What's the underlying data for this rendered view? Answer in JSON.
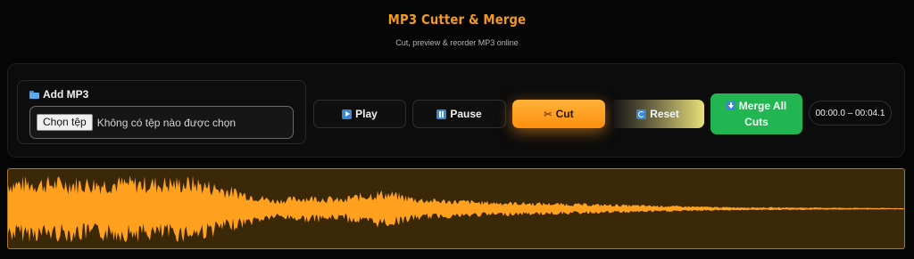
{
  "header": {
    "title": "MP3 Cutter & Merge",
    "subtitle": "Cut, preview & reorder MP3 online"
  },
  "add_panel": {
    "label": "Add MP3",
    "choose_button": "Chọn tệp",
    "file_status": "Không có tệp nào được chọn"
  },
  "controls": {
    "play": "Play",
    "pause": "Pause",
    "cut": "Cut",
    "reset": "Reset",
    "merge_line1": "Merge All",
    "merge_line2": "Cuts"
  },
  "selection_time": "00:00.0 – 00:04.1",
  "colors": {
    "accent": "#f39a1e",
    "waveform": "#ffa01e",
    "waveform_bg": "#3b2808",
    "merge_button": "#22b653"
  }
}
